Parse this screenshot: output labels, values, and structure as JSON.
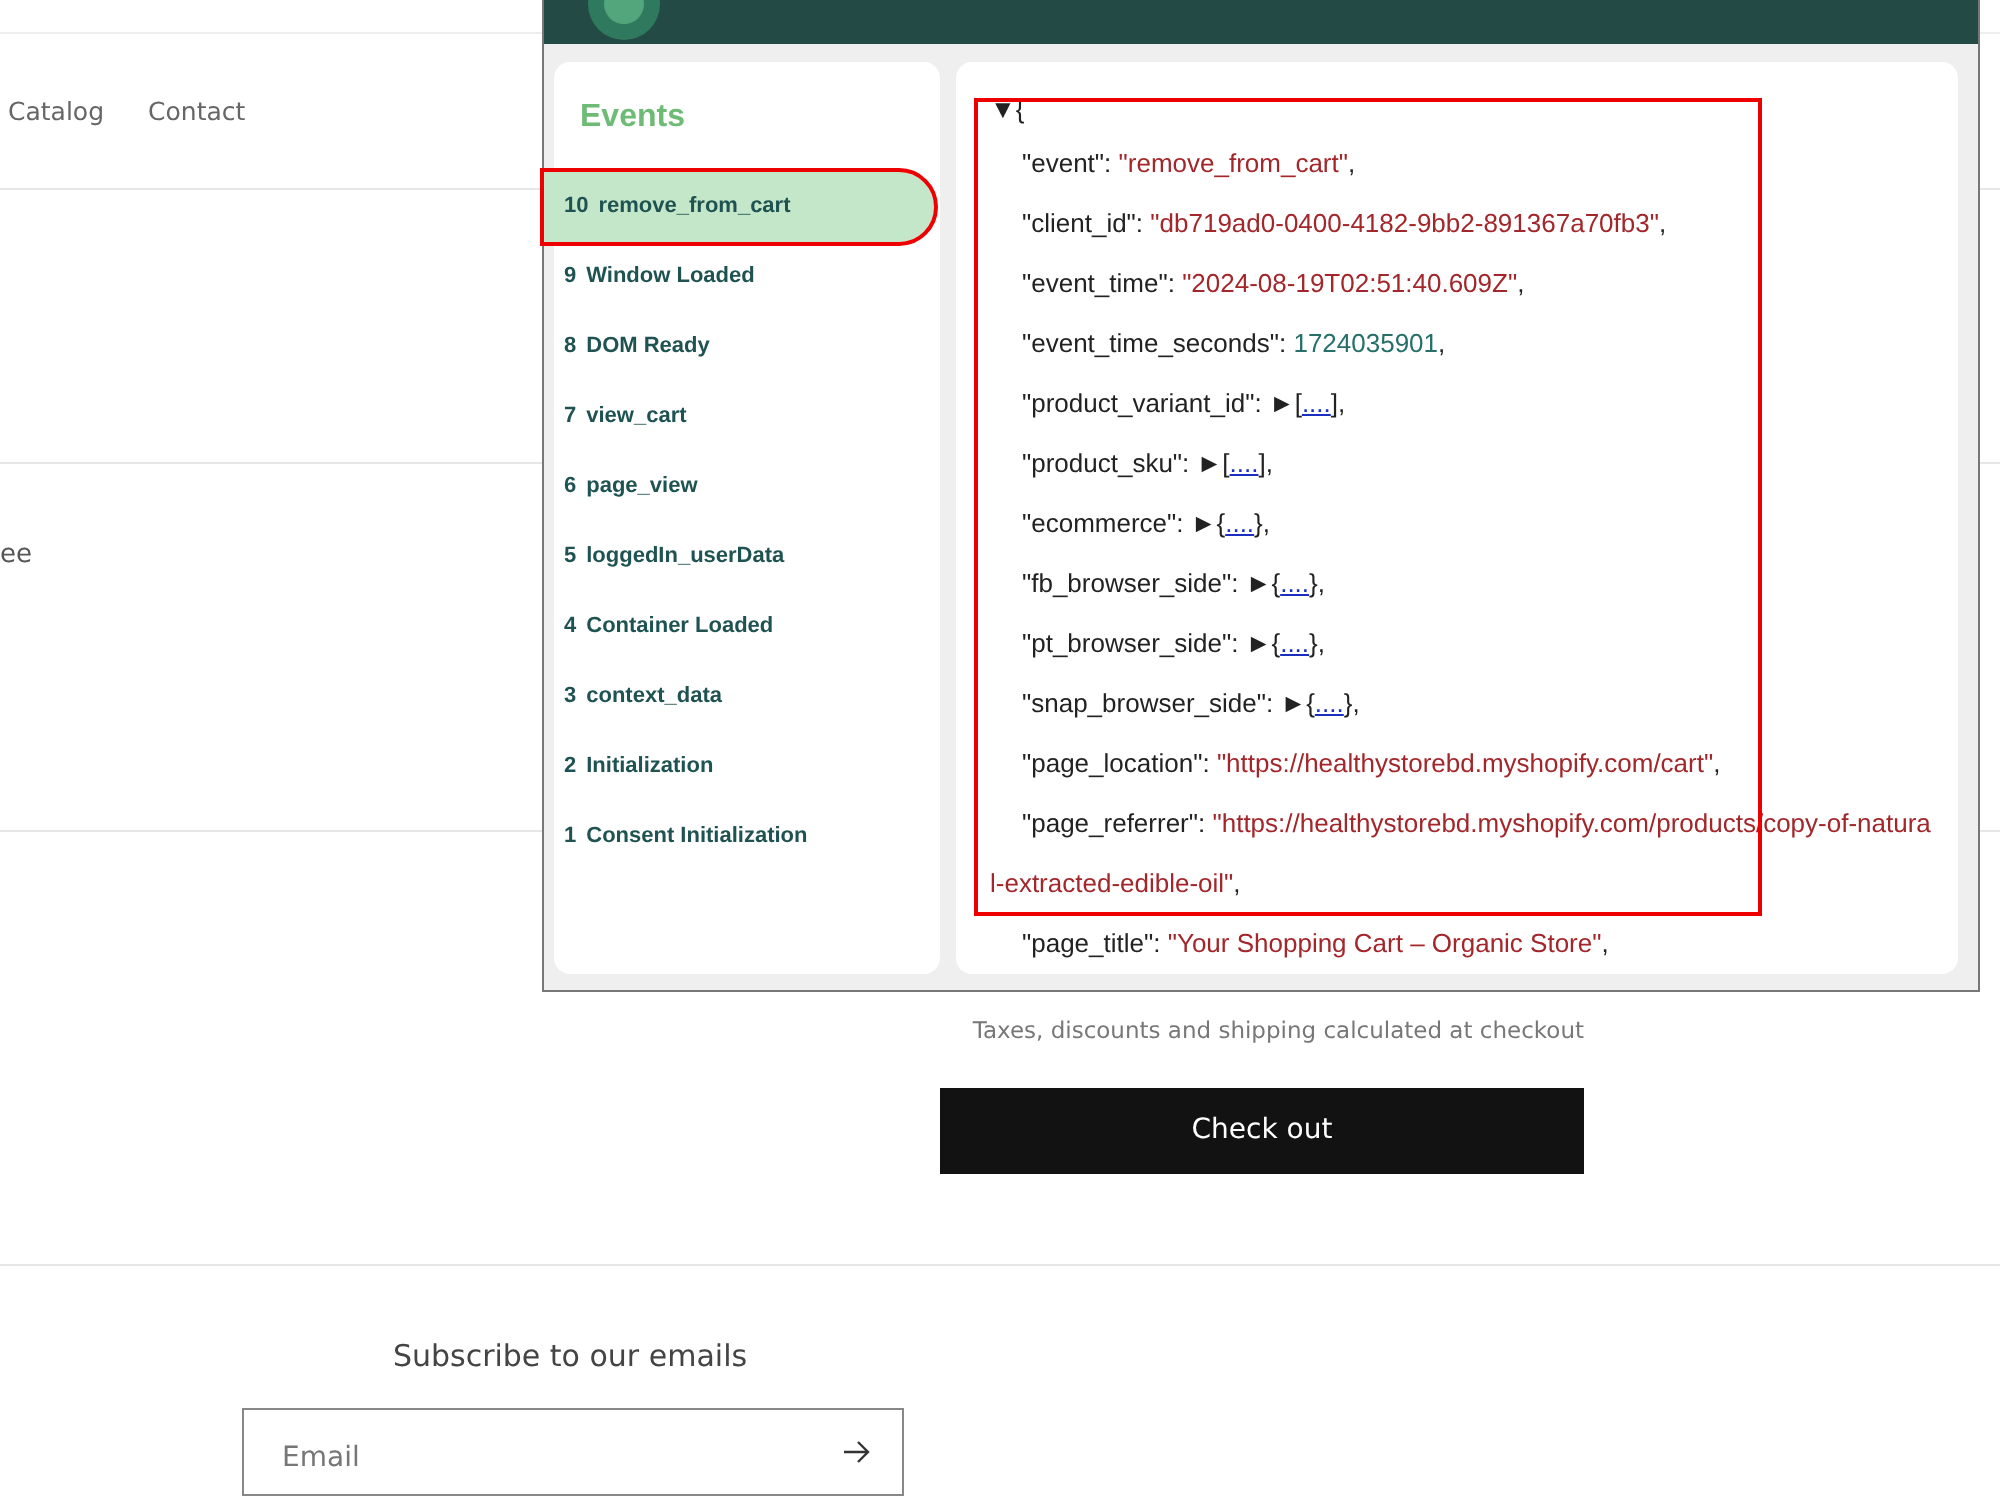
{
  "store": {
    "nav": [
      {
        "label": "Catalog"
      },
      {
        "label": "Contact"
      }
    ],
    "cut_text": "ee",
    "tax_note": "Taxes, discounts and shipping calculated at checkout",
    "checkout_button": "Check out",
    "newsletter": {
      "title": "Subscribe to our emails",
      "placeholder": "Email"
    }
  },
  "popup": {
    "events_title": "Events",
    "events": [
      {
        "number": "10",
        "name": "remove_from_cart",
        "selected": true,
        "highlighted": true
      },
      {
        "number": "9",
        "name": "Window Loaded",
        "selected": false,
        "highlighted": false
      },
      {
        "number": "8",
        "name": "DOM Ready",
        "selected": false,
        "highlighted": false
      },
      {
        "number": "7",
        "name": "view_cart",
        "selected": false,
        "highlighted": false
      },
      {
        "number": "6",
        "name": "page_view",
        "selected": false,
        "highlighted": false
      },
      {
        "number": "5",
        "name": "loggedIn_userData",
        "selected": false,
        "highlighted": false
      },
      {
        "number": "4",
        "name": "Container Loaded",
        "selected": false,
        "highlighted": false
      },
      {
        "number": "3",
        "name": "context_data",
        "selected": false,
        "highlighted": false
      },
      {
        "number": "2",
        "name": "Initialization",
        "selected": false,
        "highlighted": false
      },
      {
        "number": "1",
        "name": "Consent Initialization",
        "selected": false,
        "highlighted": false
      }
    ],
    "payload": {
      "highlighted": true,
      "toggle": "▼",
      "open": "{",
      "lines": [
        {
          "kind": "string",
          "key": "\"event\":",
          "value": "\"remove_from_cart\"",
          "end": ","
        },
        {
          "kind": "string",
          "key": "\"client_id\":",
          "value": "\"db719ad0-0400-4182-9bb2-891367a70fb3\"",
          "end": ","
        },
        {
          "kind": "string",
          "key": "\"event_time\":",
          "value": "\"2024-08-19T02:51:40.609Z\"",
          "end": ","
        },
        {
          "kind": "number",
          "key": "\"event_time_seconds\":",
          "value": "1724035901",
          "end": ","
        },
        {
          "kind": "collapsed",
          "key": "\"product_variant_id\":",
          "toggle": "►",
          "open": "[",
          "value": "....",
          "end": "],"
        },
        {
          "kind": "collapsed",
          "key": "\"product_sku\":",
          "toggle": "►",
          "open": "[",
          "value": "....",
          "end": "],"
        },
        {
          "kind": "collapsed",
          "key": "\"ecommerce\":",
          "toggle": "►",
          "open": "{",
          "value": "....",
          "end": "},"
        },
        {
          "kind": "collapsed",
          "key": "\"fb_browser_side\":",
          "toggle": "►",
          "open": "{",
          "value": "....",
          "end": "},"
        },
        {
          "kind": "collapsed",
          "key": "\"pt_browser_side\":",
          "toggle": "►",
          "open": "{",
          "value": "....",
          "end": "},"
        },
        {
          "kind": "collapsed",
          "key": "\"snap_browser_side\":",
          "toggle": "►",
          "open": "{",
          "value": "....",
          "end": "},"
        },
        {
          "kind": "string",
          "key": "\"page_location\":",
          "value": "\"https://healthystorebd.myshopify.com/cart\"",
          "end": ","
        },
        {
          "kind": "string",
          "key": "\"page_referrer\":",
          "value": "\"https://healthystorebd.myshopify.com/products/copy-of-natural-extracted-edible-oil\"",
          "end": ","
        },
        {
          "kind": "string",
          "key": "\"page_title\":",
          "value": "\"Your Shopping Cart – Organic Store\"",
          "end": ","
        }
      ]
    }
  }
}
